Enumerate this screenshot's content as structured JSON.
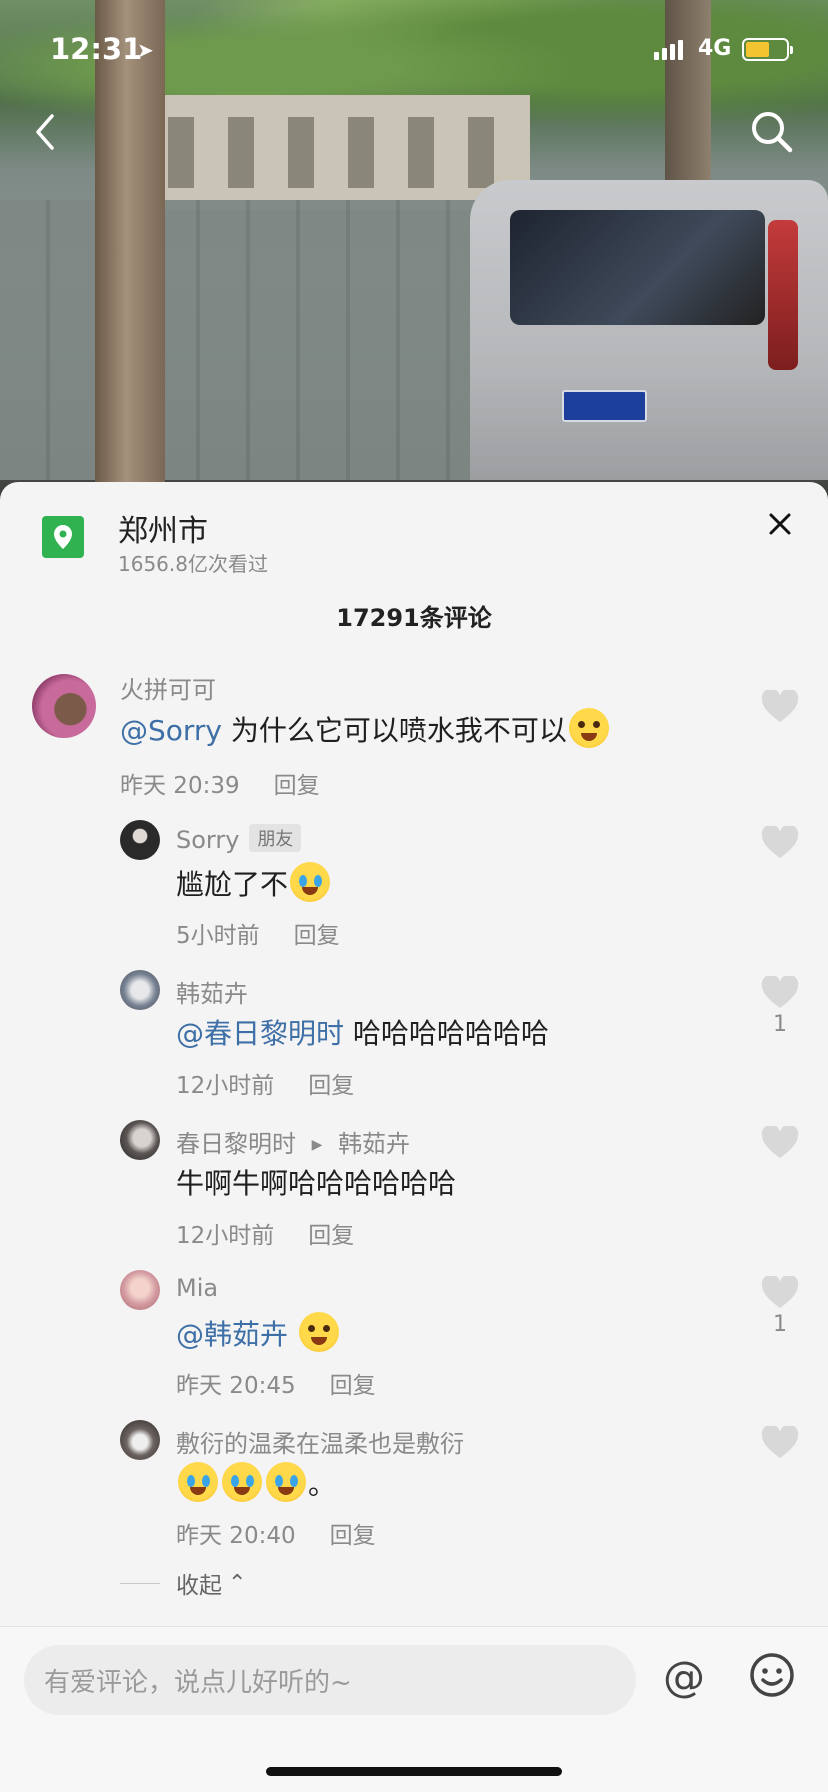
{
  "status_bar": {
    "time": "12:31",
    "network": "4G",
    "battery_fill": 0.6
  },
  "location": {
    "name": "郑州市",
    "views": "1656.8亿次看过"
  },
  "comment_count": "17291条评论",
  "comments": [
    {
      "name": "火拼可可",
      "mention": "@Sorry",
      "text": " 为什么它可以喷水我不可以",
      "time": "昨天 20:39",
      "reply": "回复",
      "likes": ""
    },
    {
      "name": "Sorry",
      "badge": "朋友",
      "text": "尴尬了不",
      "time": "5小时前",
      "reply": "回复",
      "likes": ""
    },
    {
      "name": "韩茹卉",
      "mention": "@春日黎明时",
      "text": " 哈哈哈哈哈哈哈",
      "time": "12小时前",
      "reply": "回复",
      "likes": "1"
    },
    {
      "name": "春日黎明时",
      "reply_to": "韩茹卉",
      "text": "牛啊牛啊哈哈哈哈哈哈",
      "time": "12小时前",
      "reply": "回复",
      "likes": ""
    },
    {
      "name": "Mia",
      "mention": "@韩茹卉",
      "text": " ",
      "time": "昨天 20:45",
      "reply": "回复",
      "likes": "1"
    },
    {
      "name": "敷衍的温柔在温柔也是敷衍",
      "text": "。",
      "time": "昨天 20:40",
      "reply": "回复",
      "likes": ""
    }
  ],
  "collapse_label": "收起",
  "input": {
    "placeholder": "有爱评论，说点儿好听的~"
  },
  "icons": {
    "at": "@",
    "arrow_separator": "▶",
    "collapse_chevron": "⌃"
  },
  "colors": {
    "accent_link": "#3e6fa6",
    "location_green": "#2fb24f",
    "battery": "#f4c430"
  }
}
